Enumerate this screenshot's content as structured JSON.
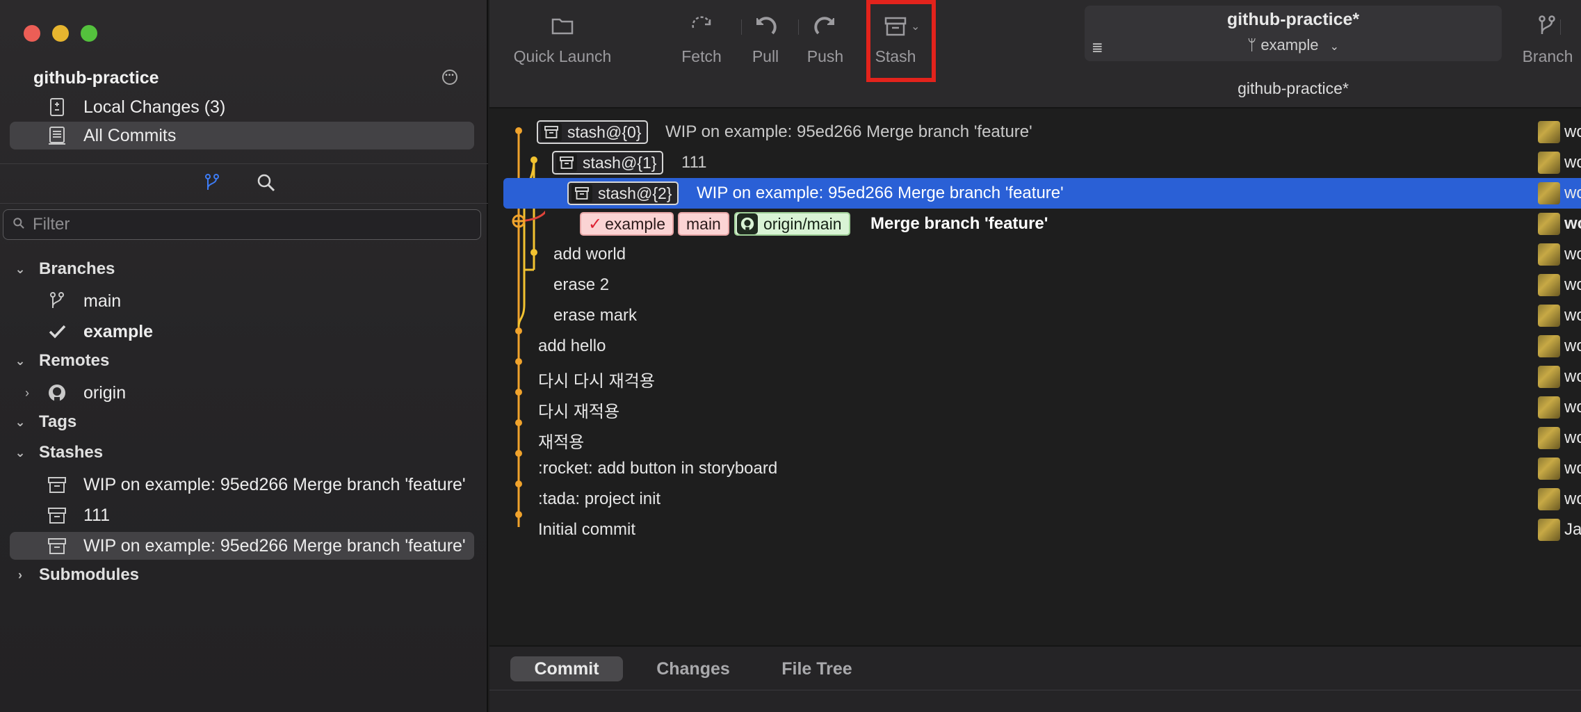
{
  "sidebar": {
    "repo_name": "github-practice",
    "workspace": [
      {
        "label": "Local Changes (3)"
      },
      {
        "label": "All Commits"
      }
    ],
    "filter_placeholder": "Filter",
    "sections": {
      "branches": "Branches",
      "remotes": "Remotes",
      "tags": "Tags",
      "stashes": "Stashes",
      "submodules": "Submodules"
    },
    "branches": [
      {
        "label": "main",
        "icon": "branch-icon"
      },
      {
        "label": "example",
        "icon": "checkmark-icon",
        "current": true
      }
    ],
    "remotes": [
      {
        "label": "origin",
        "icon": "github-icon"
      }
    ],
    "stashes": [
      {
        "label": "WIP on example: 95ed266 Merge branch 'feature'"
      },
      {
        "label": "111"
      },
      {
        "label": "WIP on example: 95ed266 Merge branch 'feature'"
      }
    ]
  },
  "toolbar": {
    "quick_launch": "Quick Launch",
    "fetch": "Fetch",
    "pull": "Pull",
    "push": "Push",
    "stash": "Stash",
    "branch": "Branch",
    "repo_title": "github-practice*",
    "current_branch": "example",
    "subtitle": "github-practice*"
  },
  "commits": [
    {
      "stash": "stash@{0}",
      "message": "WIP on example: 95ed266 Merge branch 'feature'",
      "author": "woo"
    },
    {
      "stash": "stash@{1}",
      "message": "111",
      "author": "woo"
    },
    {
      "stash": "stash@{2}",
      "message": "WIP on example: 95ed266 Merge branch 'feature'",
      "author": "woo",
      "selected": true
    },
    {
      "refs": [
        "example",
        "main",
        "origin/main"
      ],
      "message": "Merge branch 'feature'",
      "author": "woo"
    },
    {
      "message": "add world",
      "author": "woo"
    },
    {
      "message": "erase 2",
      "author": "woo"
    },
    {
      "message": "erase mark",
      "author": "woo"
    },
    {
      "message": "add hello",
      "author": "woo"
    },
    {
      "message": "다시 다시 재걱용",
      "author": "woo"
    },
    {
      "message": "다시 재적용",
      "author": "woo"
    },
    {
      "message": "재적용",
      "author": "woo"
    },
    {
      "message": ":rocket: add button in storyboard",
      "author": "woo"
    },
    {
      "message": ":tada: project init",
      "author": "woo"
    },
    {
      "message": "Initial commit",
      "author": "Jae"
    }
  ],
  "bottom_tabs": [
    "Commit",
    "Changes",
    "File Tree"
  ],
  "colors": {
    "selection": "#2a60d6",
    "graph_orange": "#f0a32c",
    "graph_yellow": "#f2c230",
    "graph_red": "#e0443a",
    "highlight_red": "#e3231c"
  }
}
